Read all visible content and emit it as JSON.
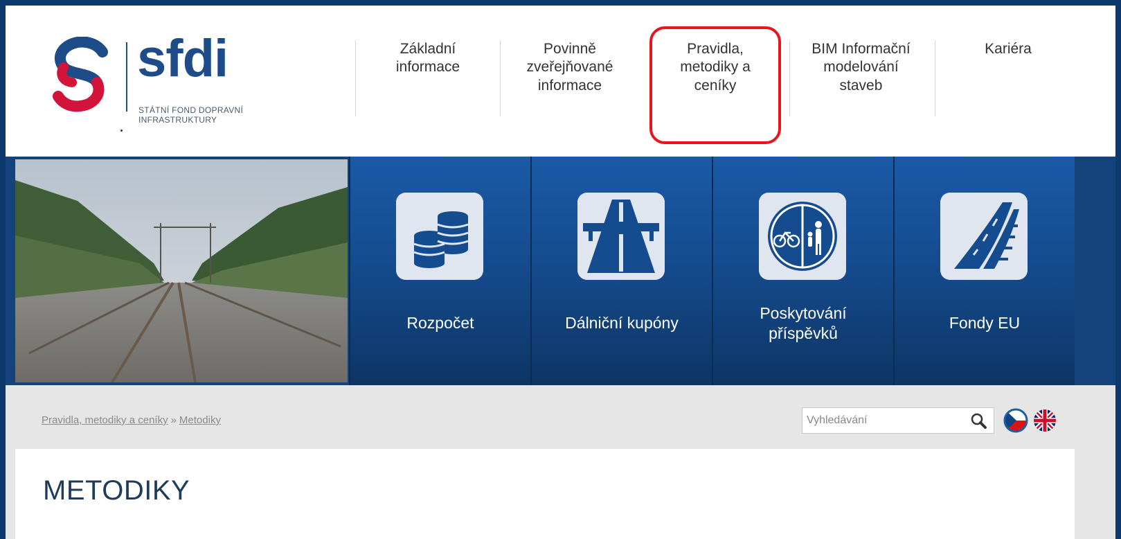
{
  "logo": {
    "name": "sfdi",
    "subtitle_line1": "STÁTNÍ FOND DOPRAVNÍ",
    "subtitle_line2": "INFRASTRUKTURY"
  },
  "nav": {
    "items": [
      {
        "label_l1": "Základní",
        "label_l2": "informace",
        "label_l3": ""
      },
      {
        "label_l1": "Povinně",
        "label_l2": "zveřejňované",
        "label_l3": "informace"
      },
      {
        "label_l1": "Pravidla,",
        "label_l2": "metodiky a",
        "label_l3": "ceníky"
      },
      {
        "label_l1": "BIM Informační",
        "label_l2": "modelování",
        "label_l3": "staveb"
      },
      {
        "label_l1": "Kariéra",
        "label_l2": "",
        "label_l3": ""
      }
    ],
    "highlight_color": "#e8161c"
  },
  "tiles": [
    {
      "label_l1": "Rozpočet",
      "label_l2": "",
      "icon": "coins-icon"
    },
    {
      "label_l1": "Dálniční kupóny",
      "label_l2": "",
      "icon": "highway-icon"
    },
    {
      "label_l1": "Poskytování",
      "label_l2": "příspěvků",
      "icon": "bike-pedestrian-sign-icon"
    },
    {
      "label_l1": "Fondy EU",
      "label_l2": "",
      "icon": "road-rail-icon"
    }
  ],
  "breadcrumb": {
    "item1": "Pravidla, metodiky a ceníky",
    "separator": "»",
    "item2": "Metodiky"
  },
  "search": {
    "placeholder": "Vyhledávání"
  },
  "page": {
    "title": "METODIKY"
  },
  "colors": {
    "brand_blue": "#1d4c88",
    "brand_red": "#d2143a",
    "tile_blue": "#154c8f"
  }
}
